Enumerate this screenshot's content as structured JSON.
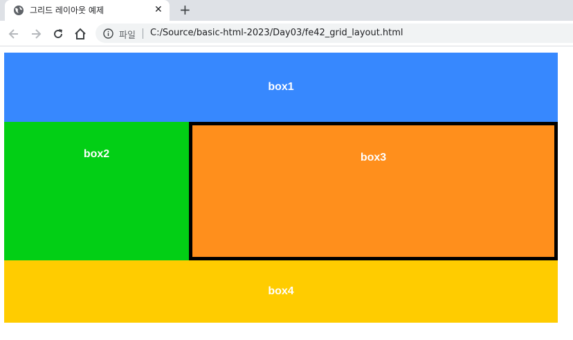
{
  "tab": {
    "title": "그리드 레이아웃 예제",
    "close": "✕",
    "new_tab": "+"
  },
  "toolbar": {
    "site_label": "파일",
    "url": "C:/Source/basic-html-2023/Day03/fe42_grid_layout.html"
  },
  "boxes": [
    {
      "label": "box1",
      "color": "#3788fe"
    },
    {
      "label": "box2",
      "color": "#02cf15"
    },
    {
      "label": "box3",
      "color": "#ff8f1c",
      "border_color": "#000000"
    },
    {
      "label": "box4",
      "color": "#ffcc00"
    }
  ],
  "icons": {
    "favicon": "globe-icon",
    "back": "back-arrow-icon",
    "forward": "forward-arrow-icon",
    "reload": "reload-icon",
    "home": "home-icon",
    "info": "info-icon"
  }
}
